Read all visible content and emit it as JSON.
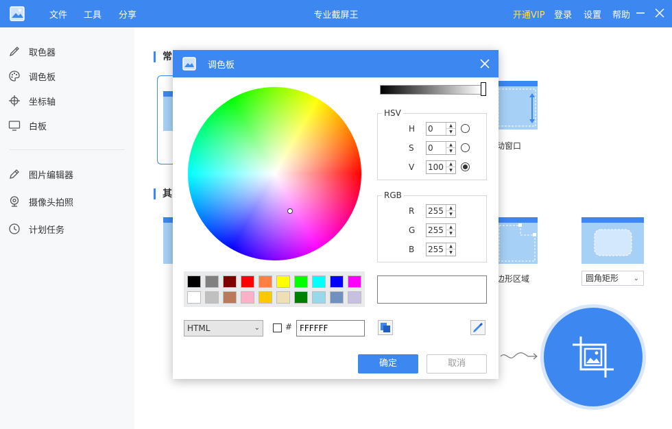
{
  "titlebar": {
    "menu": [
      "文件",
      "工具",
      "分享"
    ],
    "title": "专业截屏王",
    "vip": "开通VIP",
    "login": "登录",
    "settings": "设置",
    "help": "帮助"
  },
  "sidebar": {
    "items": [
      {
        "label": "取色器",
        "icon": "eyedropper-icon"
      },
      {
        "label": "调色板",
        "icon": "palette-icon"
      },
      {
        "label": "坐标轴",
        "icon": "crosshair-icon"
      },
      {
        "label": "白板",
        "icon": "whiteboard-icon"
      },
      {
        "label": "图片编辑器",
        "icon": "pencil-icon"
      },
      {
        "label": "摄像头拍照",
        "icon": "webcam-icon"
      },
      {
        "label": "计划任务",
        "icon": "clock-icon"
      }
    ]
  },
  "main": {
    "section1": "常",
    "section2": "其",
    "card_scroll_label": "动窗口",
    "card_polygon_label": "边形区域",
    "dropdown_value": "圆角矩形"
  },
  "dialog": {
    "title": "调色板",
    "hsv": {
      "title": "HSV",
      "h_label": "H",
      "s_label": "S",
      "v_label": "V",
      "h": "0",
      "s": "0",
      "v": "100",
      "selected": "V"
    },
    "rgb": {
      "title": "RGB",
      "r_label": "R",
      "g_label": "G",
      "b_label": "B",
      "r": "255",
      "g": "255",
      "b": "255"
    },
    "swatches_row1": [
      "#000000",
      "#808080",
      "#800000",
      "#ff0000",
      "#ff8040",
      "#ffff00",
      "#00ff00",
      "#00ffff",
      "#0000ff",
      "#ff00ff"
    ],
    "swatches_row2": [
      "#ffffff",
      "#c0c0c0",
      "#b87a5a",
      "#ffb0c8",
      "#ffc800",
      "#eedfb4",
      "#008000",
      "#99d8e8",
      "#7090c0",
      "#c8c0e0"
    ],
    "format": "HTML",
    "hash": "#",
    "hex": "FFFFFF",
    "ok": "确定",
    "cancel": "取消"
  },
  "colors": {
    "accent": "#3d87f0",
    "thumb": "#a7d0f6"
  }
}
